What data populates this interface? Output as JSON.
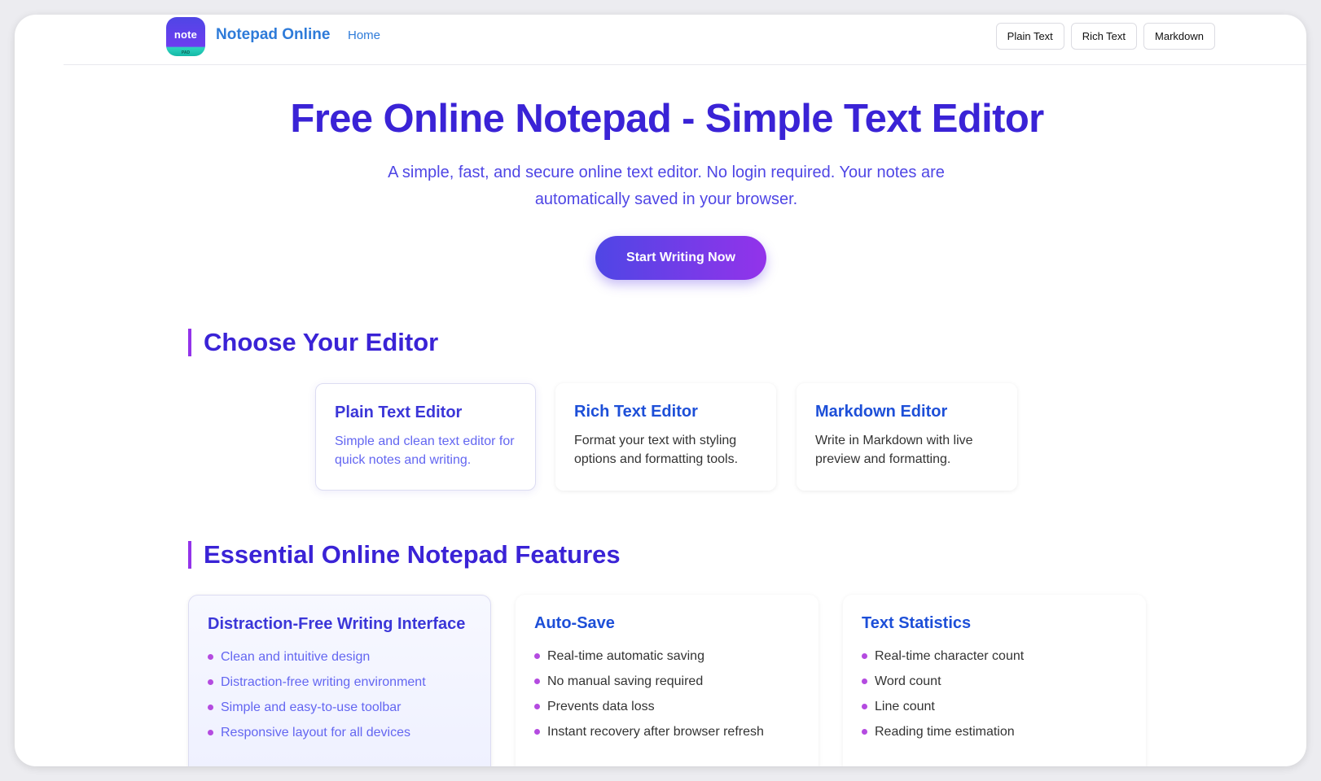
{
  "header": {
    "logo_text": "note",
    "logo_subtext": "PAD",
    "brand": "Notepad Online",
    "home_link": "Home",
    "nav_buttons": [
      "Plain Text",
      "Rich Text",
      "Markdown"
    ]
  },
  "hero": {
    "title": "Free Online Notepad - Simple Text Editor",
    "subtitle": "A simple, fast, and secure online text editor. No login required. Your notes are automatically saved in your browser.",
    "cta": "Start Writing Now"
  },
  "editors_section": {
    "heading": "Choose Your Editor",
    "cards": [
      {
        "title": "Plain Text Editor",
        "desc": "Simple and clean text editor for quick notes and writing."
      },
      {
        "title": "Rich Text Editor",
        "desc": "Format your text with styling options and formatting tools."
      },
      {
        "title": "Markdown Editor",
        "desc": "Write in Markdown with live preview and formatting."
      }
    ]
  },
  "features_section": {
    "heading": "Essential Online Notepad Features",
    "cards": [
      {
        "title": "Distraction-Free Writing Interface",
        "items": [
          "Clean and intuitive design",
          "Distraction-free writing environment",
          "Simple and easy-to-use toolbar",
          "Responsive layout for all devices"
        ]
      },
      {
        "title": "Auto-Save",
        "items": [
          "Real-time automatic saving",
          "No manual saving required",
          "Prevents data loss",
          "Instant recovery after browser refresh"
        ]
      },
      {
        "title": "Text Statistics",
        "items": [
          "Real-time character count",
          "Word count",
          "Line count",
          "Reading time estimation"
        ]
      }
    ]
  },
  "colors": {
    "accent": "#3a23d6",
    "link": "#2e7bd9",
    "gradient_start": "#4f46e5",
    "gradient_end": "#9333ea",
    "bullet": "#b44be0"
  }
}
